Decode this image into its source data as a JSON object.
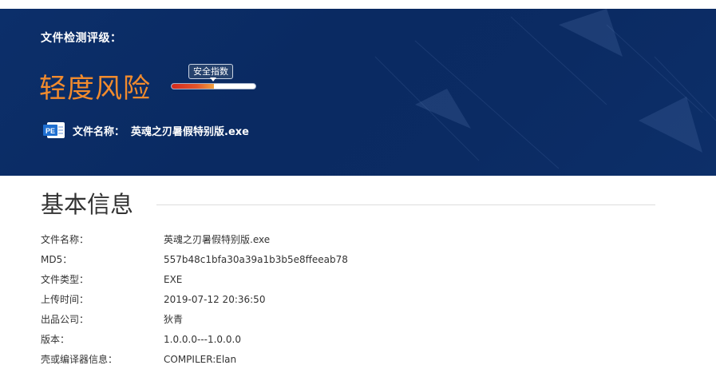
{
  "banner": {
    "rating_label": "文件检测评级：",
    "risk_level": "轻度风险",
    "risk_color": "#f28b2d",
    "safety_index": {
      "label": "安全指数",
      "level_percent": 50
    },
    "file_icon": "pe-file-icon",
    "file_icon_text": "PE",
    "file_name_label": "文件名称：",
    "file_name_value": "英魂之刃暑假特别版.exe"
  },
  "basic_info": {
    "title": "基本信息",
    "rows": [
      {
        "key": "文件名称：",
        "value": "英魂之刃暑假特别版.exe"
      },
      {
        "key": "MD5：",
        "value": "557b48c1bfa30a39a1b3b5e8ffeeab78"
      },
      {
        "key": "文件类型：",
        "value": "EXE"
      },
      {
        "key": "上传时间：",
        "value": "2019-07-12 20:36:50"
      },
      {
        "key": "出品公司：",
        "value": "狄青"
      },
      {
        "key": "版本：",
        "value": "1.0.0.0---1.0.0.0"
      },
      {
        "key": "壳或编译器信息：",
        "value": "COMPILER:Elan"
      }
    ]
  }
}
